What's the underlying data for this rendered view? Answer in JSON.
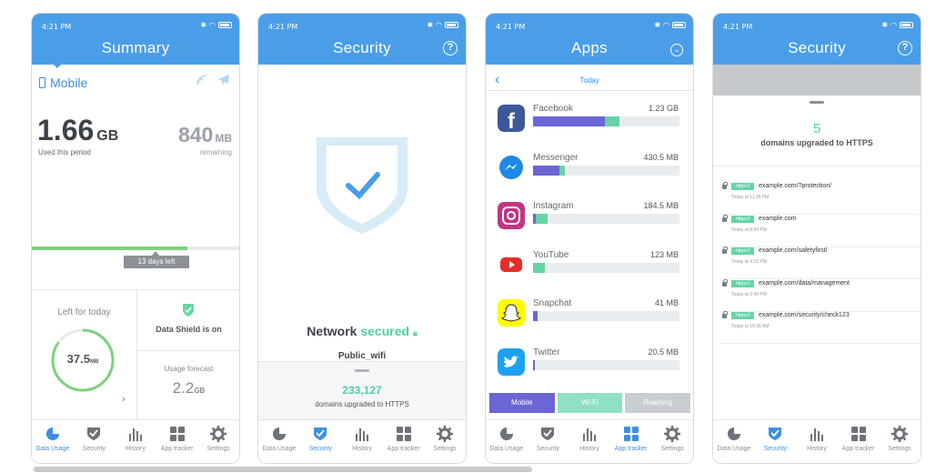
{
  "status_time": "4:21 PM",
  "tabs": [
    "Data Usage",
    "Security",
    "History",
    "App tracker",
    "Settings"
  ],
  "summary": {
    "title": "Summary",
    "mobile_label": "Mobile",
    "used_value": "1.66",
    "used_unit": "GB",
    "used_label": "Used this period",
    "remaining_value": "840",
    "remaining_unit": "MB",
    "remaining_label": "remaining",
    "period_progress": 0.75,
    "days_left": "13 days left",
    "left_today_label": "Left for today",
    "left_today_value": "37.5",
    "left_today_unit": "MB",
    "left_today_fraction": 0.85,
    "shield_label": "Data Shield is on",
    "forecast_label": "Usage forecast",
    "forecast_value": "2.2",
    "forecast_unit": "GB"
  },
  "security": {
    "title": "Security",
    "network_prefix": "Network",
    "network_status": "secured",
    "wifi_name": "Public_wifi",
    "upgraded_count": "233,127",
    "upgraded_label": "domains upgraded to HTTPS"
  },
  "apps": {
    "title": "Apps",
    "period": "Today",
    "items": [
      {
        "name": "Facebook",
        "size": "1.23 GB",
        "primary": 0.49,
        "secondary": 0.1,
        "icon": "facebook-icon",
        "color": "#3b5998"
      },
      {
        "name": "Messenger",
        "size": "430.5 MB",
        "primary": 0.18,
        "secondary": 0.04,
        "icon": "messenger-icon",
        "color": "#1e88e5"
      },
      {
        "name": "Instagram",
        "size": "184.5 MB",
        "primary": 0.02,
        "secondary": 0.08,
        "icon": "instagram-icon",
        "color": "#c13584"
      },
      {
        "name": "YouTube",
        "size": "123 MB",
        "primary": 0.0,
        "secondary": 0.08,
        "icon": "youtube-icon",
        "color": "#e52d27"
      },
      {
        "name": "Snapchat",
        "size": "41 MB",
        "primary": 0.03,
        "secondary": 0.0,
        "icon": "snapchat-icon",
        "color": "#fffc00"
      },
      {
        "name": "Twitter",
        "size": "20.5 MB",
        "primary": 0.01,
        "secondary": 0.0,
        "icon": "twitter-icon",
        "color": "#1da1f2"
      }
    ],
    "segments": [
      "Mobile",
      "Wi-Fi",
      "Roaming"
    ]
  },
  "security_list": {
    "title": "Security",
    "count": "5",
    "count_label": "domains upgraded to HTTPS",
    "tag": "https://",
    "domains": [
      {
        "url": "example.com/?protection/",
        "time": "Today at 11:36 PM"
      },
      {
        "url": "example.com",
        "time": "Today at 8:54 PM"
      },
      {
        "url": "example.com/safetyfirst/",
        "time": "Today at 4:13 PM"
      },
      {
        "url": "example.com/data/management",
        "time": "Today at 2:49 PM"
      },
      {
        "url": "example.com/security/check123",
        "time": "Today at 10:36 AM"
      }
    ]
  }
}
